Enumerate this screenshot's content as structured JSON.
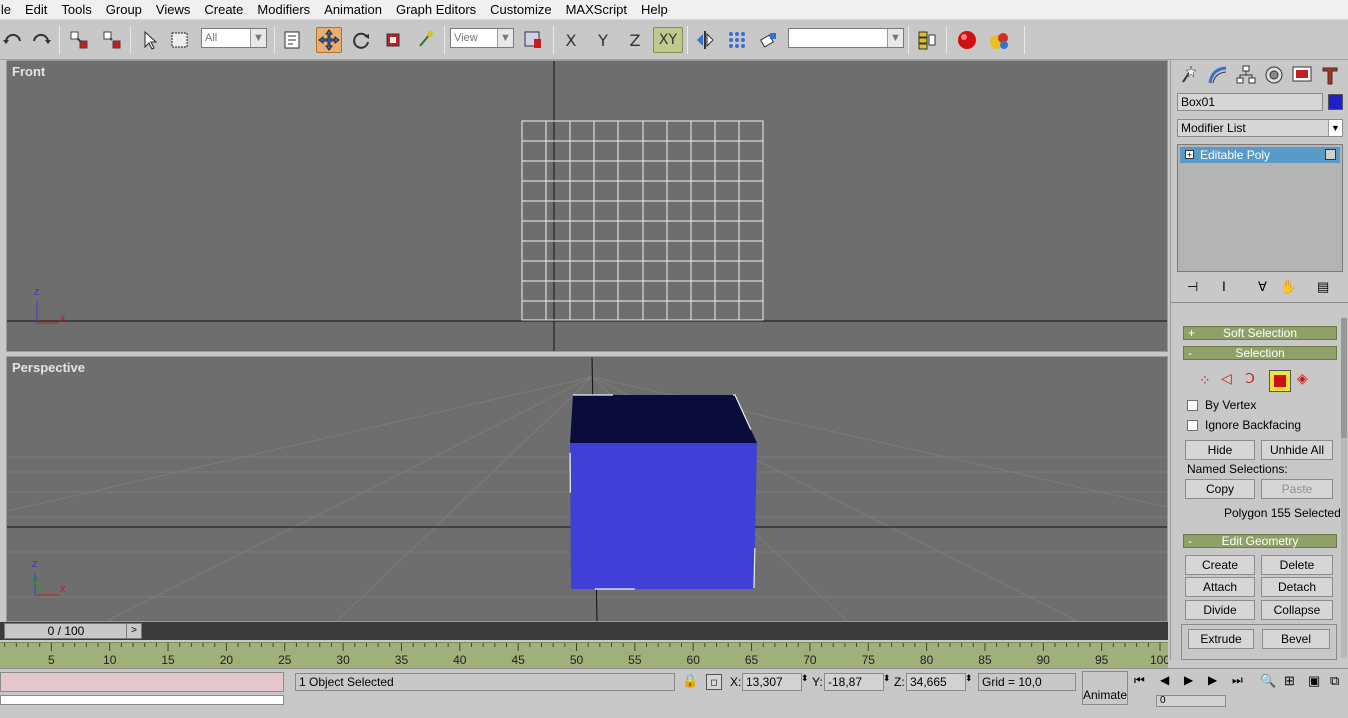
{
  "menu": [
    "ile",
    "Edit",
    "Tools",
    "Group",
    "Views",
    "Create",
    "Modifiers",
    "Animation",
    "Graph Editors",
    "Customize",
    "MAXScript",
    "Help"
  ],
  "toolbar": {
    "selection_filter": "All",
    "ref_coord": "View",
    "axis_x": "X",
    "axis_y": "Y",
    "axis_z": "Z",
    "axis_xy": "XY",
    "named_selection": ""
  },
  "viewports": {
    "front": {
      "label": "Front",
      "axis_z": "z",
      "axis_x": "x"
    },
    "perspective": {
      "label": "Perspective",
      "axis_z": "z",
      "axis_y": "y",
      "axis_x": "x"
    }
  },
  "command_panel": {
    "object_name": "Box01",
    "object_color": "#2020c8",
    "modifier_list": "Modifier List",
    "stack_item": "Editable Poly",
    "rollouts": {
      "soft_selection": "Soft Selection",
      "selection": "Selection",
      "edit_geometry": "Edit Geometry"
    },
    "by_vertex": "By Vertex",
    "ignore_backfacing": "Ignore Backfacing",
    "hide": "Hide",
    "unhide_all": "Unhide All",
    "named_selections": "Named Selections:",
    "copy": "Copy",
    "paste": "Paste",
    "polygon_status": "Polygon 155 Selected",
    "create": "Create",
    "delete": "Delete",
    "attach": "Attach",
    "detach": "Detach",
    "divide": "Divide",
    "collapse": "Collapse",
    "extrude": "Extrude",
    "bevel": "Bevel"
  },
  "timeline": {
    "frame_display": "0 / 100",
    "ticks": [
      "5",
      "10",
      "15",
      "20",
      "25",
      "30",
      "35",
      "40",
      "45",
      "50",
      "55",
      "60",
      "65",
      "70",
      "75",
      "80",
      "85",
      "90",
      "95",
      "100"
    ]
  },
  "status": {
    "selected": "1 Object Selected",
    "x_label": "X:",
    "x": "13,307",
    "y_label": "Y:",
    "y": "-18,87",
    "z_label": "Z:",
    "z": "34,665",
    "grid": "Grid = 10,0",
    "animate": "Animate",
    "frame": "0"
  }
}
